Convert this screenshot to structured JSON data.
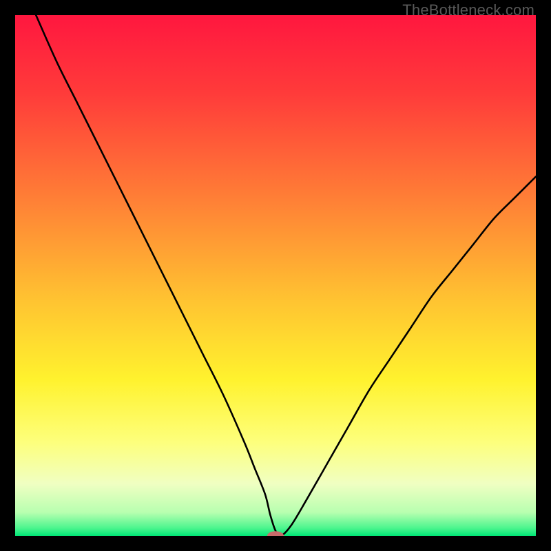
{
  "watermark": "TheBottleneck.com",
  "chart_data": {
    "type": "line",
    "title": "",
    "xlabel": "",
    "ylabel": "",
    "xlim": [
      0,
      100
    ],
    "ylim": [
      0,
      100
    ],
    "grid": false,
    "legend": false,
    "series": [
      {
        "name": "curve",
        "x": [
          4,
          8,
          12,
          16,
          20,
          24,
          28,
          32,
          36,
          40,
          44,
          46,
          48,
          49,
          50,
          51,
          53,
          56,
          60,
          64,
          68,
          72,
          76,
          80,
          84,
          88,
          92,
          96,
          100
        ],
        "y": [
          100,
          91,
          83,
          75,
          67,
          59,
          51,
          43,
          35,
          27,
          18,
          13,
          8,
          4,
          1,
          0,
          2,
          7,
          14,
          21,
          28,
          34,
          40,
          46,
          51,
          56,
          61,
          65,
          69
        ]
      }
    ],
    "marker": {
      "x": 50,
      "y": 0,
      "rx": 1.6,
      "ry": 0.9,
      "color": "#c96b6b"
    },
    "background_gradient": {
      "stops": [
        {
          "offset": 0.0,
          "color": "#ff173f"
        },
        {
          "offset": 0.15,
          "color": "#ff3b3a"
        },
        {
          "offset": 0.35,
          "color": "#ff7e36"
        },
        {
          "offset": 0.55,
          "color": "#ffc431"
        },
        {
          "offset": 0.7,
          "color": "#fff22e"
        },
        {
          "offset": 0.82,
          "color": "#fdff7c"
        },
        {
          "offset": 0.9,
          "color": "#f0ffc2"
        },
        {
          "offset": 0.955,
          "color": "#b8ffb0"
        },
        {
          "offset": 0.985,
          "color": "#4cf58e"
        },
        {
          "offset": 1.0,
          "color": "#00e676"
        }
      ]
    }
  }
}
